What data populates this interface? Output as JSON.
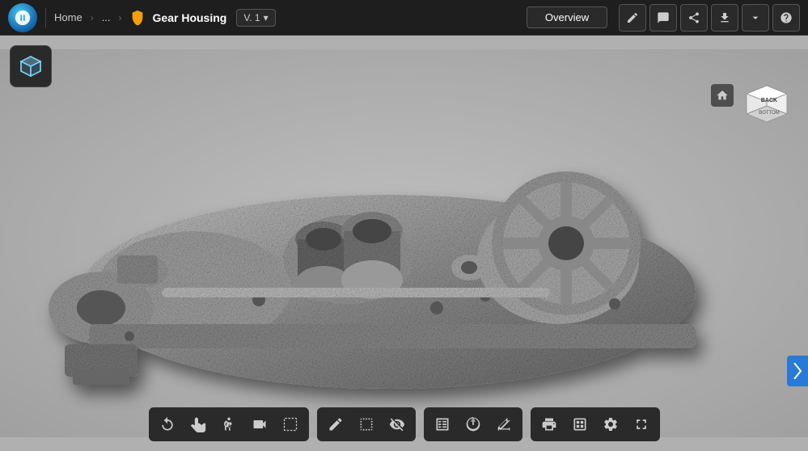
{
  "app": {
    "logo_alt": "Autodesk",
    "title": "Gear Housing"
  },
  "breadcrumb": {
    "home": "Home",
    "ellipsis": "...",
    "item": "Gear Housing"
  },
  "version": {
    "label": "V. 1",
    "chevron": "▾"
  },
  "header": {
    "overview_label": "Overview"
  },
  "right_toolbar": {
    "icons": [
      {
        "name": "pencil-icon",
        "symbol": "✎",
        "label": "Edit"
      },
      {
        "name": "comment-icon",
        "symbol": "💬",
        "label": "Comment"
      },
      {
        "name": "share-icon",
        "symbol": "⤴",
        "label": "Share"
      },
      {
        "name": "download-icon",
        "symbol": "⬇",
        "label": "Download"
      },
      {
        "name": "chevron-down-icon",
        "symbol": "▾",
        "label": "More"
      },
      {
        "name": "help-icon",
        "symbol": "?",
        "label": "Help"
      }
    ]
  },
  "bottom_toolbar": {
    "group1": [
      {
        "name": "rotate-tool",
        "symbol": "↻",
        "label": "Rotate",
        "active": false
      },
      {
        "name": "pan-tool",
        "symbol": "✋",
        "label": "Pan",
        "active": false
      },
      {
        "name": "walk-tool",
        "symbol": "🚶",
        "label": "Walk",
        "active": false
      },
      {
        "name": "camera-tool",
        "symbol": "🎥",
        "label": "Camera",
        "active": false
      },
      {
        "name": "selection-tool",
        "symbol": "⬚",
        "label": "Selection",
        "active": false
      }
    ],
    "group2": [
      {
        "name": "markup-tool",
        "symbol": "✏",
        "label": "Markup",
        "active": false
      },
      {
        "name": "section-tool",
        "symbol": "▣",
        "label": "Section",
        "active": false
      },
      {
        "name": "hide-tool",
        "symbol": "◎",
        "label": "Hide",
        "active": false
      }
    ],
    "group3": [
      {
        "name": "model-browser-tool",
        "symbol": "⬡",
        "label": "Model Browser",
        "active": false
      },
      {
        "name": "properties-tool",
        "symbol": "⬡↑",
        "label": "Properties",
        "active": false
      },
      {
        "name": "measure-tool",
        "symbol": "↔",
        "label": "Measure",
        "active": false
      }
    ],
    "group4": [
      {
        "name": "print-tool",
        "symbol": "🖨",
        "label": "Print",
        "active": false
      },
      {
        "name": "view-tool",
        "symbol": "▣",
        "label": "View",
        "active": false
      },
      {
        "name": "settings-tool",
        "symbol": "⚙",
        "label": "Settings",
        "active": false
      },
      {
        "name": "fullscreen-tool",
        "symbol": "⛶",
        "label": "Fullscreen",
        "active": false
      }
    ]
  },
  "viewport": {
    "bg_color": "#b0b0b0",
    "home_icon": "⌂",
    "expand_icon": "❯"
  },
  "colors": {
    "topbar_bg": "#1e1e1e",
    "toolbar_bg": "#2a2a2a",
    "accent_blue": "#2979d8",
    "viewport_bg": "#b0b0b0"
  }
}
